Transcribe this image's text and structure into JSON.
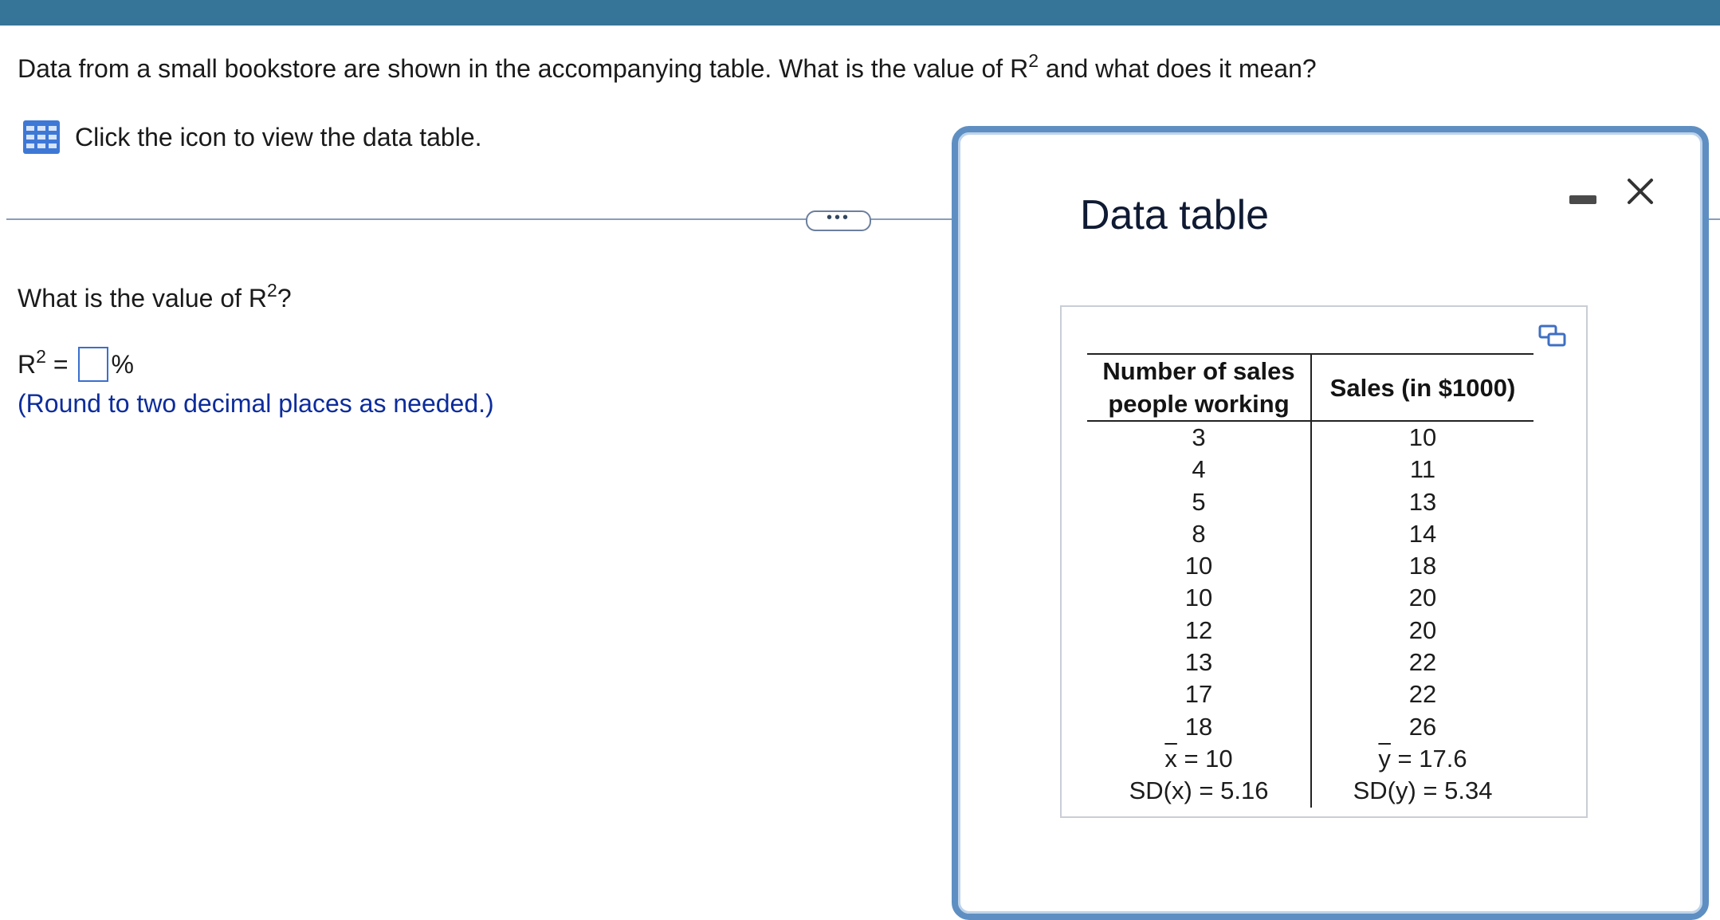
{
  "colors": {
    "top_bar": "#367597",
    "hint": "#0c2c9c",
    "modal_border": "#5f8fc2",
    "input_border": "#3a6fd0"
  },
  "question": {
    "text_before": "Data from a small bookstore are shown in the accompanying table. What is the value of R",
    "superscript": "2",
    "text_after": " and what does it mean?"
  },
  "data_link": {
    "icon": "table-grid-icon",
    "label": "Click the icon to view the data table."
  },
  "divider": {
    "toggle_label": "•••"
  },
  "sub_question": {
    "text_before": "What is the value of R",
    "superscript": "2",
    "text_after": "?"
  },
  "answer": {
    "prefix_base": "R",
    "prefix_superscript": "2",
    "prefix_equals": " =",
    "value": "",
    "suffix": "%",
    "hint": "(Round to two decimal places as needed.)"
  },
  "modal": {
    "title": "Data table",
    "minimize_icon": "minimize-icon",
    "close_icon": "close-icon",
    "copy_icon": "copy-icon",
    "table": {
      "headers": [
        "Number of sales people working",
        "Sales (in $1000)"
      ],
      "header_col1_line1": "Number of sales",
      "header_col1_line2": "people working",
      "rows": [
        [
          "3",
          "10"
        ],
        [
          "4",
          "11"
        ],
        [
          "5",
          "13"
        ],
        [
          "8",
          "14"
        ],
        [
          "10",
          "18"
        ],
        [
          "10",
          "20"
        ],
        [
          "12",
          "20"
        ],
        [
          "13",
          "22"
        ],
        [
          "17",
          "22"
        ],
        [
          "18",
          "26"
        ]
      ],
      "mean_x_symbol": "x",
      "mean_x_value": " = 10",
      "mean_y_symbol": "y",
      "mean_y_value": " = 17.6",
      "sd_x": "SD(x) = 5.16",
      "sd_y": "SD(y) = 5.34"
    }
  }
}
